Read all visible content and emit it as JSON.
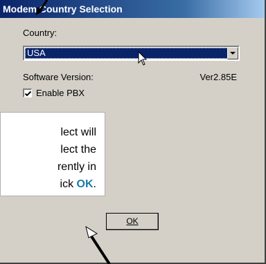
{
  "window": {
    "title": "Modem Country Selection"
  },
  "form": {
    "country_label": "Country:",
    "country_value": "USA",
    "software_label": "Software Version:",
    "software_value": "Ver2.85E",
    "pbx_label": "Enable PBX",
    "pbx_checked": true,
    "ok_label": "OK"
  },
  "callout": {
    "line1": "lect will",
    "line2": "lect the",
    "line3": "rently in",
    "line4_prefix": "ick ",
    "line4_bold": "OK",
    "line4_suffix": "."
  },
  "icons": {
    "dropdown": "chevron-down-icon",
    "check": "check-icon",
    "cursor": "mouse-pointer-icon"
  }
}
